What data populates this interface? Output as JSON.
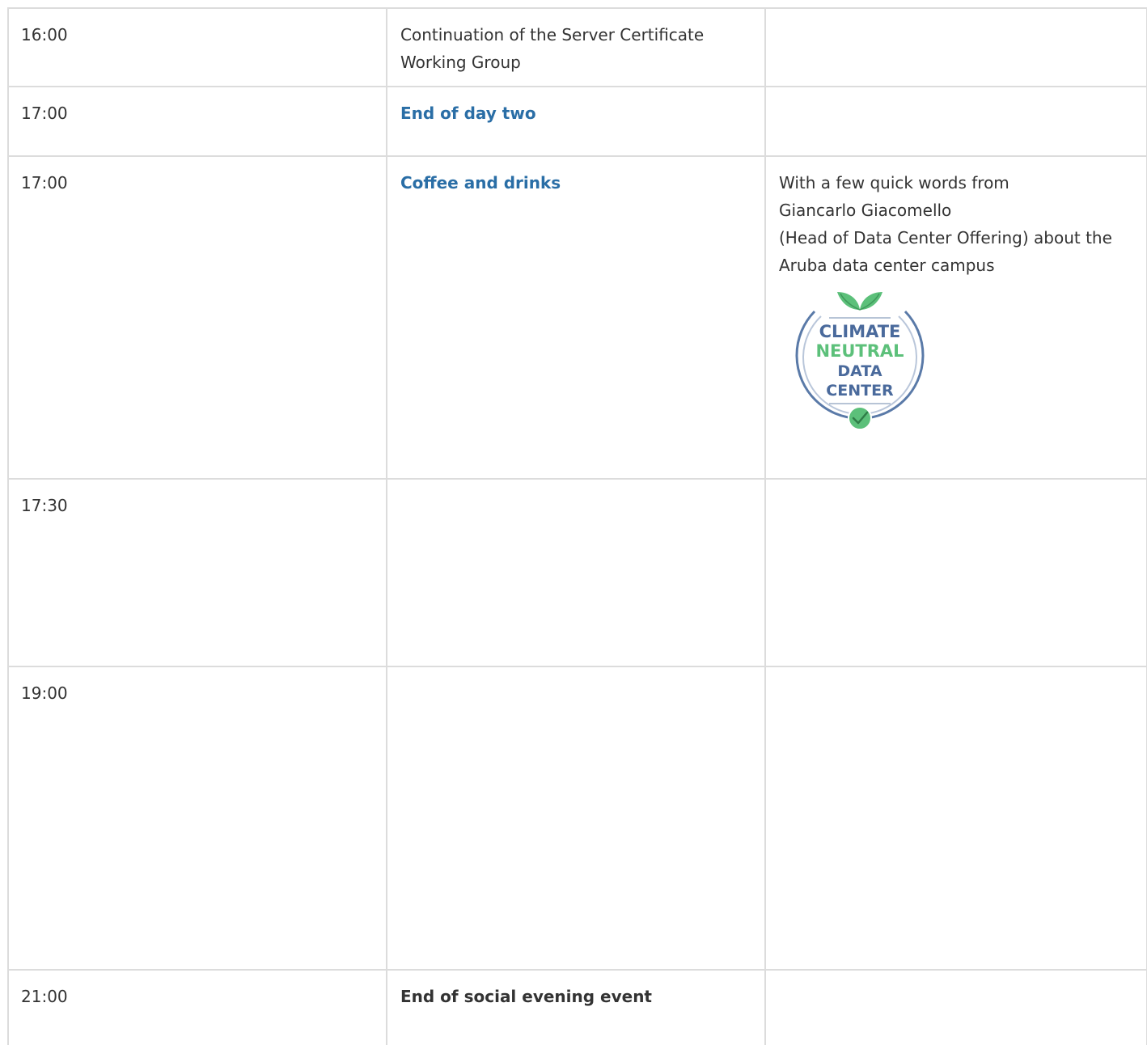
{
  "rows": [
    {
      "time": "16:00",
      "event": "Continuation of the Server Certificate Working Group",
      "notes": []
    },
    {
      "time": "17:00",
      "event": "End of day two",
      "notes": []
    },
    {
      "time": "17:00",
      "event": "Coffee and drinks",
      "notes": [
        "With a few quick words from",
        "Giancarlo Giacomello",
        "(Head of Data Center Offering) about the",
        "Aruba data center campus"
      ],
      "badge": {
        "line1": "CLIMATE",
        "line2": "NEUTRAL",
        "line3": "DATA",
        "line4": "CENTER",
        "color_primary": "#4a6a9c",
        "color_accent": "#5cc07a"
      }
    },
    {
      "time": "17:30",
      "event": "",
      "notes": []
    },
    {
      "time": "19:00",
      "event": "",
      "notes": []
    },
    {
      "time": "21:00",
      "event": "End of social evening event",
      "notes": []
    }
  ],
  "colors": {
    "text": "#333333",
    "link": "#2a6ea6",
    "border": "#dcdcdc"
  }
}
